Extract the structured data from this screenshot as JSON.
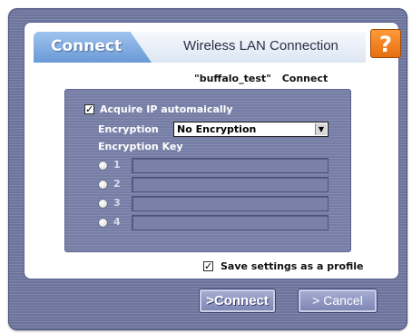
{
  "header": {
    "tab_label": "Connect",
    "title": "Wireless LAN Connection",
    "help_label": "?"
  },
  "network": {
    "ssid": "\"buffalo_test\"",
    "action": "Connect"
  },
  "settings": {
    "acquire_ip": {
      "label": "Acquire IP automaically",
      "checked": true
    },
    "encryption": {
      "label": "Encryption",
      "value": "No Encryption"
    },
    "encryption_key": {
      "label": "Encryption Key",
      "keys": [
        {
          "label": "1",
          "value": ""
        },
        {
          "label": "2",
          "value": ""
        },
        {
          "label": "3",
          "value": ""
        },
        {
          "label": "4",
          "value": ""
        }
      ]
    }
  },
  "save_profile": {
    "label": "Save settings as a profile",
    "checked": true
  },
  "buttons": {
    "connect": ">Connect",
    "cancel": "> Cancel"
  },
  "colors": {
    "tab_blue": "#6a9ad6",
    "help_orange": "#e46f10",
    "frame": "#7f86ab"
  }
}
